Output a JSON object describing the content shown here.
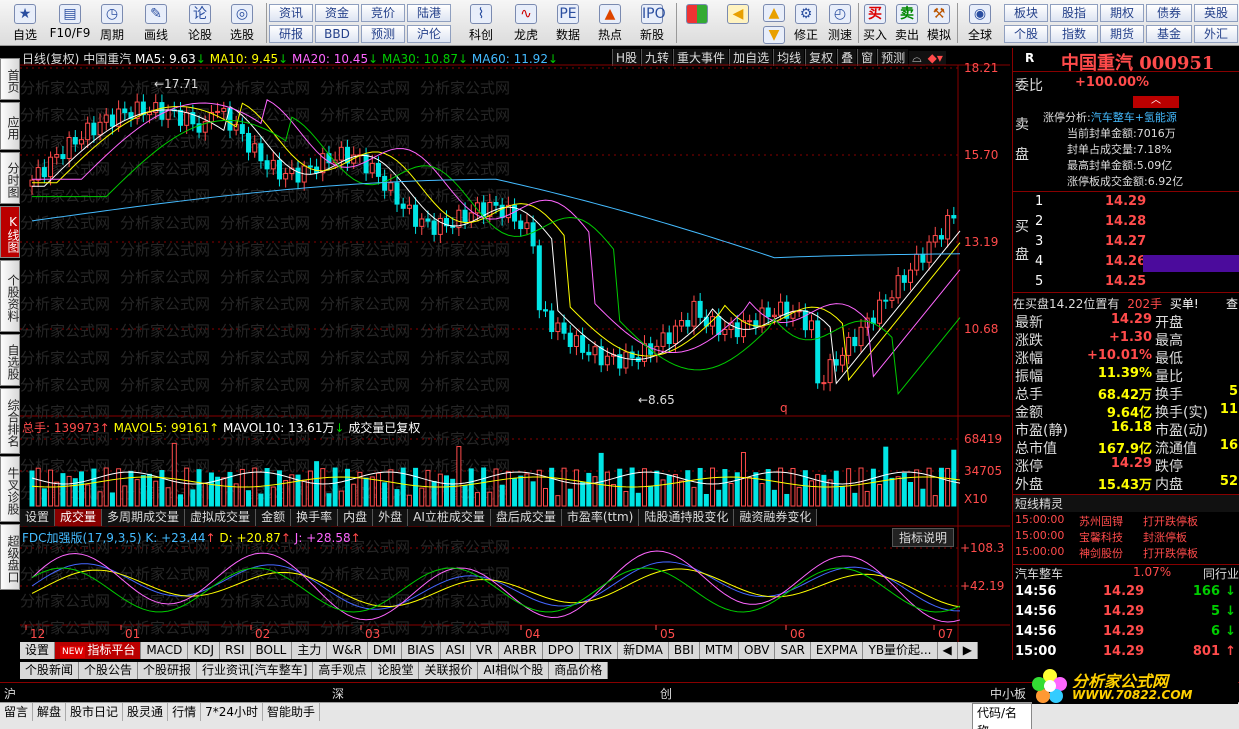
{
  "toolbar": {
    "buttons": [
      {
        "label": "自选",
        "icon": "star-icon"
      },
      {
        "label": "F10/F9",
        "icon": "f10-icon"
      },
      {
        "label": "周期",
        "icon": "clock-icon"
      },
      {
        "label": "画线",
        "icon": "pencil-icon"
      },
      {
        "label": "论股",
        "icon": "discuss-icon"
      },
      {
        "label": "选股",
        "icon": "select-stock-icon"
      },
      {
        "label": "科创",
        "icon": "kechuang-icon"
      },
      {
        "label": "龙虎",
        "icon": "longhu-icon"
      },
      {
        "label": "数据",
        "icon": "pe-data-icon"
      },
      {
        "label": "热点",
        "icon": "hot-icon"
      },
      {
        "label": "新股",
        "icon": "ipo-icon"
      },
      {
        "label": "修正",
        "icon": "gear-icon"
      },
      {
        "label": "测速",
        "icon": "speedtest-icon"
      },
      {
        "label": "买入",
        "icon": "buy-icon"
      },
      {
        "label": "卖出",
        "icon": "sell-icon"
      },
      {
        "label": "模拟",
        "icon": "simulate-icon"
      },
      {
        "label": "全球",
        "icon": "globe-icon"
      }
    ],
    "grid1": [
      "资讯",
      "资金",
      "竞价",
      "陆港",
      "研报",
      "BBD",
      "预测",
      "沪伦"
    ],
    "grid2": [
      "板块",
      "股指",
      "期权",
      "债券",
      "英股",
      "个股",
      "指数",
      "期货",
      "基金",
      "外汇"
    ]
  },
  "left_tabs": [
    "首页",
    "应用",
    "分时图",
    "K线图",
    "个股资料",
    "自选股",
    "综合排名",
    "牛叉诊股",
    "超级盘口"
  ],
  "kline": {
    "header": {
      "period_label": "日线(复权)",
      "stock_name": "中国重汽",
      "ma5": "MA5: 9.63",
      "ma10": "MA10: 9.45",
      "ma20": "MA20: 10.45",
      "ma30": "MA30: 10.87",
      "ma60": "MA60: 11.92"
    },
    "top_buttons": [
      "H股",
      "九转",
      "重大事件",
      "加自选",
      "均线",
      "复权",
      "叠",
      "窗",
      "预测"
    ],
    "price_ticks": [
      "18.21",
      "15.70",
      "13.19",
      "10.68"
    ],
    "high_marker": "17.71",
    "low_marker": "8.65",
    "q_marker": "q",
    "watermark": "分析家公式网"
  },
  "volume": {
    "header": {
      "total": "总手: 139973",
      "mavol5": "MAVOL5: 99161",
      "mavol10": "MAVOL10: 13.61万",
      "note": "成交量已复权"
    },
    "ticks": [
      "68419",
      "34705",
      "X10"
    ],
    "tabs": [
      "设置",
      "成交量",
      "多周期成交量",
      "虚拟成交量",
      "金额",
      "换手率",
      "内盘",
      "外盘",
      "AI立桩成交量",
      "盘后成交量",
      "市盈率(ttm)",
      "陆股通持股变化",
      "融资融券变化"
    ]
  },
  "indicator": {
    "header": {
      "name": "FDC加强版(17,9,3,5)",
      "k": "K: +23.44",
      "d": "D: +20.87",
      "j": "J: +28.58"
    },
    "ticks": [
      "+108.3",
      "+42.19"
    ],
    "explain_button": "指标说明"
  },
  "x_axis": [
    "12",
    "01",
    "02",
    "03",
    "04",
    "05",
    "06",
    "07"
  ],
  "indicator_tabs": [
    "设置",
    "指标平台",
    "MACD",
    "KDJ",
    "RSI",
    "BOLL",
    "主力",
    "W&R",
    "DMI",
    "BIAS",
    "ASI",
    "VR",
    "ARBR",
    "DPO",
    "TRIX",
    "新DMA",
    "BBI",
    "MTM",
    "OBV",
    "SAR",
    "EXPMA",
    "YB量价起..."
  ],
  "new_badge": "NEW",
  "news_tabs": [
    "个股新闻",
    "个股公告",
    "个股研报",
    "行业资讯[汽车整车]",
    "高手观点",
    "论股堂",
    "关联报价",
    "AI相似个股",
    "商品价格"
  ],
  "index_bar": {
    "sh": "沪",
    "sz": "深",
    "cy": "创",
    "zxb": "中小板"
  },
  "status_bar": [
    "留言",
    "解盘",
    "股市日记",
    "股灵通",
    "行情",
    "7*24小时",
    "智能助手"
  ],
  "status_right": "代码/名称",
  "right_panel": {
    "r_label": "R",
    "title": "中国重汽 000951",
    "weibi_label": "委比",
    "weibi_value": "+100.00%",
    "sell_label": "卖盘",
    "limit_up": {
      "title": "涨停分析:",
      "sectors": "汽车整车+氢能源",
      "lines": [
        "当前封单金额:7016万",
        "封单占成交量:7.18%",
        "最高封单金额:5.09亿",
        "涨停板成交金额:6.92亿"
      ]
    },
    "buy_label": "买盘",
    "bids": [
      {
        "level": "1",
        "price": "14.29"
      },
      {
        "level": "2",
        "price": "14.28"
      },
      {
        "level": "3",
        "price": "14.27"
      },
      {
        "level": "4",
        "price": "14.26"
      },
      {
        "level": "5",
        "price": "14.25"
      }
    ],
    "buy_notice": {
      "text": "在买盘14.22位置有",
      "qty": "202手",
      "action": "买单!",
      "more": "查"
    },
    "quote": [
      {
        "l": "最新",
        "v": "14.29",
        "l2": "开盘",
        "v2": ""
      },
      {
        "l": "涨跌",
        "v": "+1.30",
        "l2": "最高",
        "v2": ""
      },
      {
        "l": "涨幅",
        "v": "+10.01%",
        "l2": "最低",
        "v2": ""
      },
      {
        "l": "振幅",
        "v": "11.39%",
        "l2": "量比",
        "v2": ""
      },
      {
        "l": "总手",
        "v": "68.42万",
        "l2": "换手",
        "v2": "5"
      },
      {
        "l": "金额",
        "v": "9.64亿",
        "l2": "换手(实)",
        "v2": "11"
      },
      {
        "l": "市盈(静)",
        "v": "16.18",
        "l2": "市盈(动)",
        "v2": ""
      },
      {
        "l": "总市值",
        "v": "167.9亿",
        "l2": "流通值",
        "v2": "16"
      },
      {
        "l": "涨停",
        "v": "14.29",
        "l2": "跌停",
        "v2": ""
      },
      {
        "l": "外盘",
        "v": "15.43万",
        "l2": "内盘",
        "v2": "52"
      }
    ],
    "shortline_title": "短线精灵",
    "shortline": [
      {
        "t": "15:00:00",
        "name": "苏州固锝",
        "evt": "打开跌停板"
      },
      {
        "t": "15:00:00",
        "name": "宝馨科技",
        "evt": "封涨停板"
      },
      {
        "t": "15:00:00",
        "name": "神剑股份",
        "evt": "打开跌停板"
      }
    ],
    "sector": {
      "name": "汽车整车",
      "pct": "1.07%",
      "link": "同行业"
    },
    "ticks": [
      {
        "t": "14:56",
        "p": "14.29",
        "v": "166",
        "dir": "down"
      },
      {
        "t": "14:56",
        "p": "14.29",
        "v": "5",
        "dir": "down"
      },
      {
        "t": "14:56",
        "p": "14.29",
        "v": "6",
        "dir": "down"
      },
      {
        "t": "15:00",
        "p": "14.29",
        "v": "801",
        "dir": "up"
      }
    ]
  },
  "logo": {
    "cn": "分析家公式网",
    "url": "WWW.70822.COM"
  },
  "colors": {
    "up": "#ff4b4b",
    "down": "#00e5e5",
    "ma5": "#ffffff",
    "ma10": "#ffff00",
    "ma20": "#ff66ff",
    "ma30": "#00cc00",
    "ma60": "#44bbff",
    "bg": "#000000",
    "grid": "#8b0000"
  }
}
